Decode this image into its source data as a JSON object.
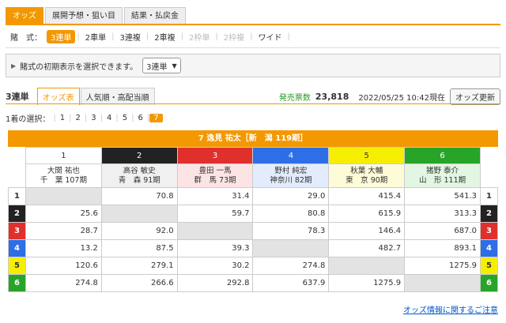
{
  "tabs": [
    "オッズ",
    "展開予想・狙い目",
    "結果・払戻金"
  ],
  "bet_types": {
    "label": "賭　式：",
    "items": [
      {
        "label": "3連単",
        "state": "active"
      },
      {
        "label": "2車単",
        "state": "normal"
      },
      {
        "label": "3連複",
        "state": "normal"
      },
      {
        "label": "2車複",
        "state": "normal"
      },
      {
        "label": "2枠単",
        "state": "disabled"
      },
      {
        "label": "2枠複",
        "state": "disabled"
      },
      {
        "label": "ワイド",
        "state": "normal"
      }
    ]
  },
  "initial_display": {
    "text": "賭式の初期表示を選択できます。",
    "selected": "3連単"
  },
  "sub_header": {
    "title": "3連単",
    "tabs": [
      "オッズ表",
      "人気順・高配当順"
    ],
    "sales_label": "発売票数",
    "sales_value": "23,818",
    "timestamp": "2022/05/25 10:42現在",
    "update_button": "オッズ更新"
  },
  "first_select": {
    "label": "1着の選択：",
    "options": [
      "1",
      "2",
      "3",
      "4",
      "5",
      "6",
      "7"
    ],
    "active": "7"
  },
  "table": {
    "header": "7 逸見 祐太［新　潟 119期］",
    "columns": [
      {
        "num": "1",
        "name": "大関 祐也",
        "region": "千　葉 107期",
        "color": "#ffffff",
        "text": "#333333",
        "name_bg": "#ffffff"
      },
      {
        "num": "2",
        "name": "高谷 敏史",
        "region": "青　森 91期",
        "color": "#222222",
        "text": "#ffffff",
        "name_bg": "#f0f0f0"
      },
      {
        "num": "3",
        "name": "豊田 一馬",
        "region": "群　馬 73期",
        "color": "#e0302c",
        "text": "#ffffff",
        "name_bg": "#fde4e4"
      },
      {
        "num": "4",
        "name": "野村 純宏",
        "region": "神奈川 82期",
        "color": "#2e6ee6",
        "text": "#ffffff",
        "name_bg": "#e2ecfc"
      },
      {
        "num": "5",
        "name": "秋葉 大輔",
        "region": "東　京 90期",
        "color": "#f5ee00",
        "text": "#333333",
        "name_bg": "#fdfbd8"
      },
      {
        "num": "6",
        "name": "猪野 泰介",
        "region": "山　形 111期",
        "color": "#28a428",
        "text": "#ffffff",
        "name_bg": "#e2f6e2"
      }
    ],
    "rows": [
      {
        "lane": "1",
        "values": [
          "",
          "70.8",
          "31.4",
          "29.0",
          "415.4",
          "541.3"
        ]
      },
      {
        "lane": "2",
        "values": [
          "25.6",
          "",
          "59.7",
          "80.8",
          "615.9",
          "313.3"
        ]
      },
      {
        "lane": "3",
        "values": [
          "28.7",
          "92.0",
          "",
          "78.3",
          "146.4",
          "687.0"
        ]
      },
      {
        "lane": "4",
        "values": [
          "13.2",
          "87.5",
          "39.3",
          "",
          "482.7",
          "893.1"
        ]
      },
      {
        "lane": "5",
        "values": [
          "120.6",
          "279.1",
          "30.2",
          "274.8",
          "",
          "1275.9"
        ]
      },
      {
        "lane": "6",
        "values": [
          "274.8",
          "266.6",
          "292.8",
          "637.9",
          "1275.9",
          ""
        ]
      }
    ]
  },
  "footer_link": "オッズ情報に関するご注意"
}
